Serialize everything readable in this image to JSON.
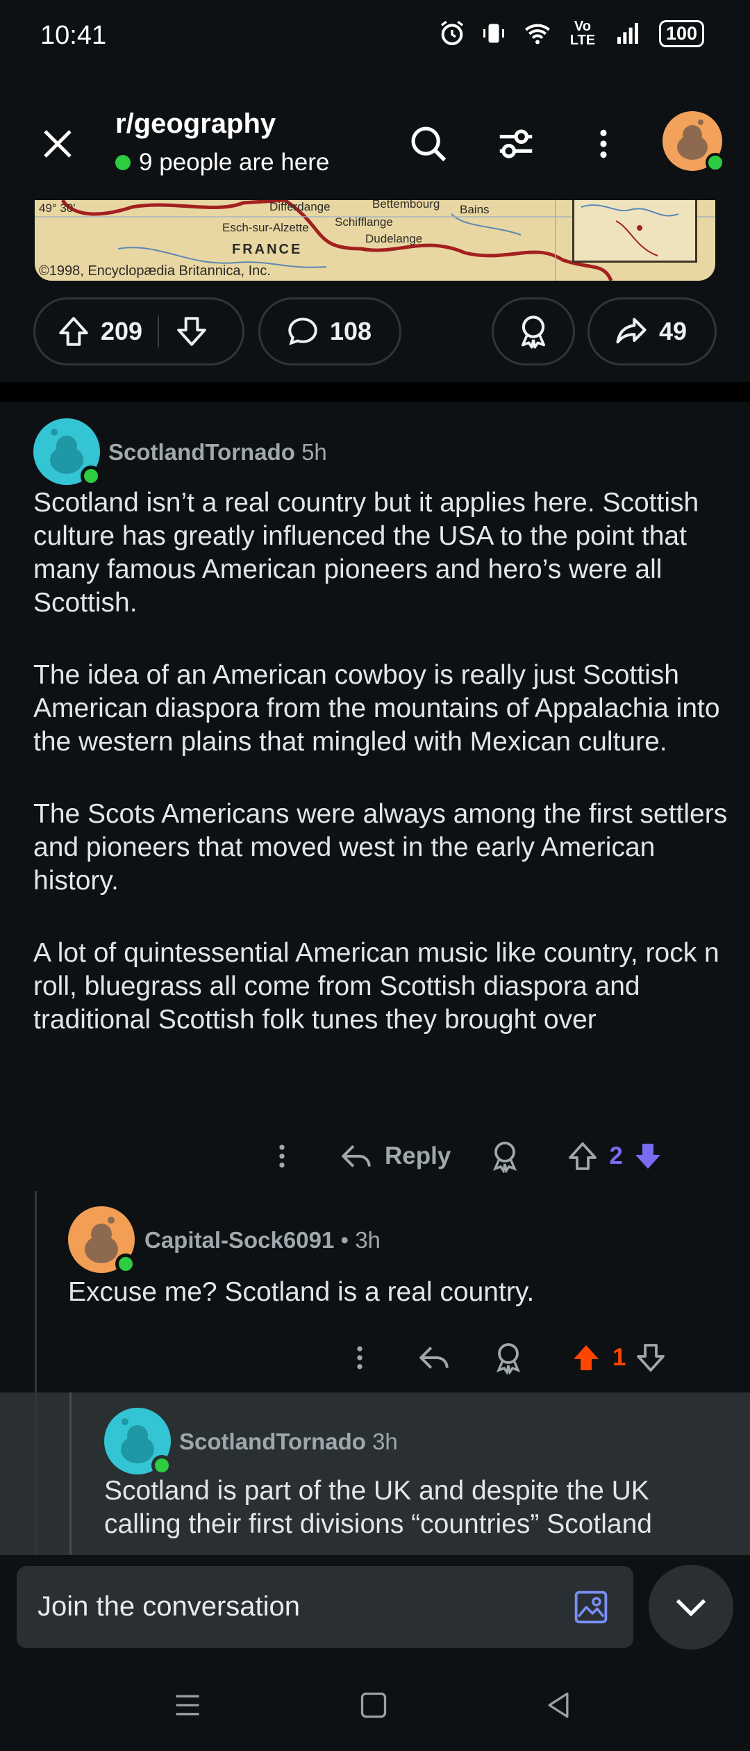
{
  "status": {
    "time": "10:41",
    "battery": "100",
    "network": "Vo LTE"
  },
  "header": {
    "title": "r/geography",
    "presence": "9 people are here"
  },
  "map": {
    "lat_label": "49° 30'",
    "places": [
      "Differdange",
      "Bettembourg",
      "Bains",
      "Esch-sur-Alzette",
      "Schifflange",
      "Dudelange",
      "FRANCE"
    ],
    "credit": "©1998, Encyclopædia Britannica, Inc."
  },
  "post_actions": {
    "upvotes": "209",
    "comments": "108",
    "shares": "49"
  },
  "comments": [
    {
      "author": "ScotlandTornado",
      "time": "5h",
      "paragraphs": [
        "Scotland isn’t a real country but it applies here. Scottish culture has greatly influenced the USA to the point that many famous American pioneers and hero’s were all Scottish.",
        "The idea of an American cowboy is really just Scottish American diaspora from the mountains of Appalachia into the western plains that mingled with Mexican culture.",
        "The Scots Americans were always among the first settlers and pioneers that moved west in the early American history.",
        "A lot of quintessential American music like country, rock n roll, bluegrass all come from Scottish diaspora and traditional Scottish folk tunes they brought over"
      ],
      "reply_label": "Reply",
      "score": "2"
    },
    {
      "author": "Capital-Sock6091",
      "time": "• 3h",
      "text": "Excuse me? Scotland is a real country.",
      "score": "1"
    },
    {
      "author": "ScotlandTornado",
      "time": "3h",
      "text": "Scotland is part of the UK and despite the UK calling their first divisions “countries” Scotland"
    }
  ],
  "composer": {
    "placeholder": "Join the conversation"
  },
  "colors": {
    "upvote": "#ff4500",
    "downvote": "#7a6cf2",
    "online": "#2ecc40"
  }
}
